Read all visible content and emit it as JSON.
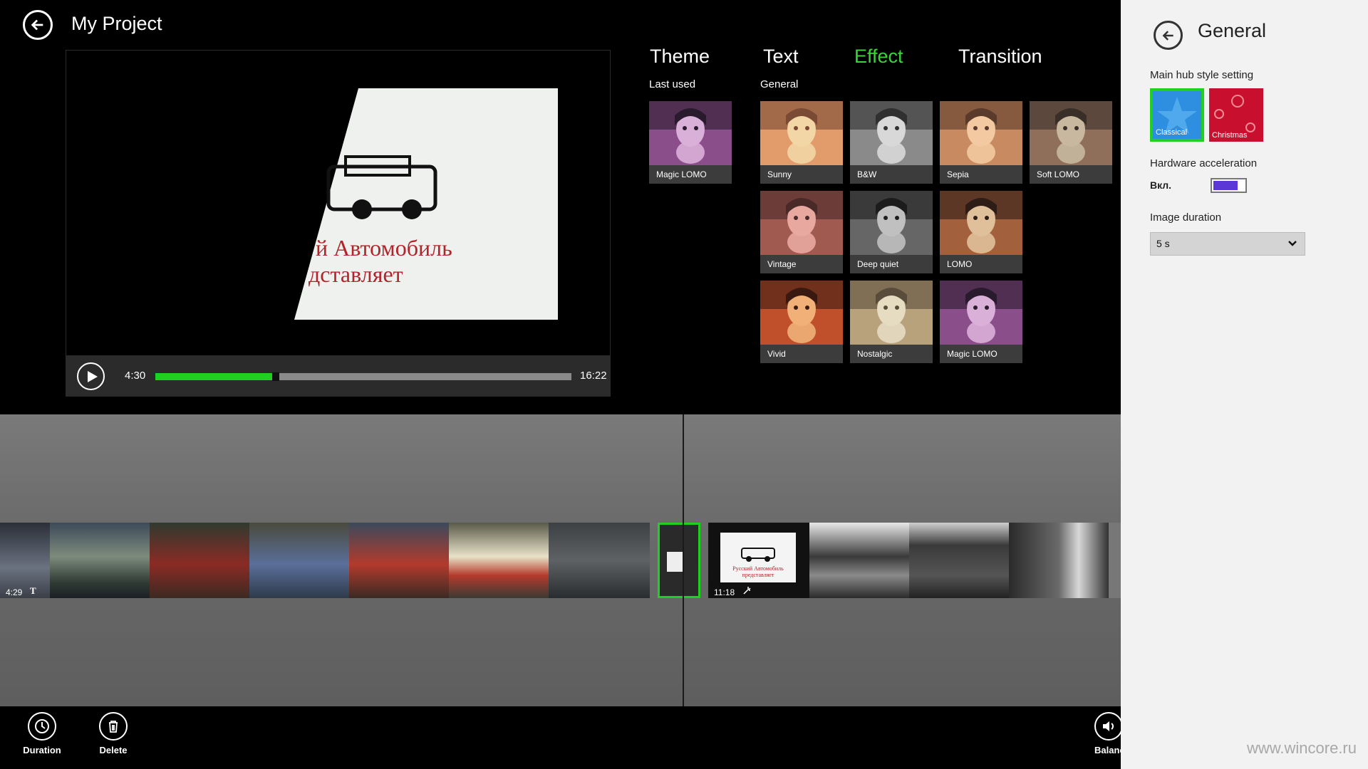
{
  "header": {
    "title": "My Project",
    "back_icon": "back-arrow-icon"
  },
  "player": {
    "current_time": "4:30",
    "total_time": "16:22",
    "progress": 0.28,
    "preview_text_line1": "й Автомобиль",
    "preview_text_line2": "дставляет"
  },
  "tabs": [
    {
      "label": "Theme",
      "active": false
    },
    {
      "label": "Text",
      "active": false
    },
    {
      "label": "Effect",
      "active": true
    },
    {
      "label": "Transition",
      "active": false
    }
  ],
  "sections": {
    "last_used": "Last used",
    "general": "General"
  },
  "last_used": [
    {
      "label": "Magic LOMO"
    }
  ],
  "effects": [
    {
      "label": "Sunny"
    },
    {
      "label": "B&W"
    },
    {
      "label": "Sepia"
    },
    {
      "label": "Soft LOMO"
    },
    {
      "label": "Vintage"
    },
    {
      "label": "Deep quiet"
    },
    {
      "label": "LOMO"
    },
    {
      "label": "Vivid"
    },
    {
      "label": "Nostalgic"
    },
    {
      "label": "Magic LOMO"
    }
  ],
  "flyout": {
    "title": "General",
    "main_hub_label": "Main hub style setting",
    "styles": [
      {
        "label": "Classical",
        "selected": true
      },
      {
        "label": "Christmas",
        "selected": false
      }
    ],
    "hw_accel_label": "Hardware acceleration",
    "hw_accel_state": "Вкл.",
    "image_duration_label": "Image duration",
    "image_duration_value": "5 s"
  },
  "timeline": {
    "left_time": "4:29",
    "left_icon": "T",
    "right_time": "11:18",
    "right_clip_text": "Русский Автомобиль представляет"
  },
  "appbar": [
    {
      "label": "Duration",
      "icon": "clock-icon"
    },
    {
      "label": "Delete",
      "icon": "trash-icon"
    },
    {
      "label": "Balance",
      "icon": "speaker-icon"
    }
  ],
  "watermark": "www.wincore.ru",
  "colors": {
    "accent": "#1fd11f",
    "tab_active": "#3ad43a",
    "toggle": "#5b37d8"
  }
}
